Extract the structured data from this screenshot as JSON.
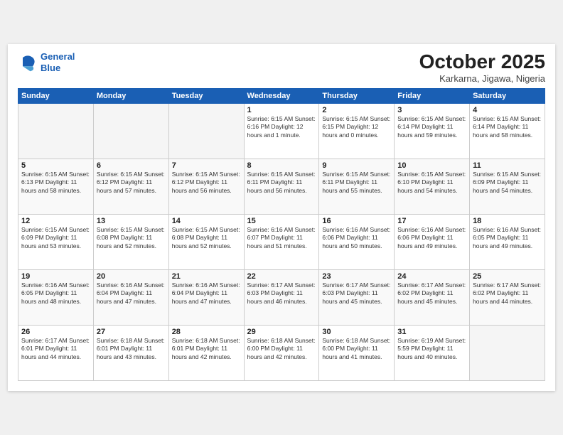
{
  "header": {
    "logo_line1": "General",
    "logo_line2": "Blue",
    "month_title": "October 2025",
    "location": "Karkarna, Jigawa, Nigeria"
  },
  "weekdays": [
    "Sunday",
    "Monday",
    "Tuesday",
    "Wednesday",
    "Thursday",
    "Friday",
    "Saturday"
  ],
  "weeks": [
    [
      {
        "num": "",
        "info": ""
      },
      {
        "num": "",
        "info": ""
      },
      {
        "num": "",
        "info": ""
      },
      {
        "num": "1",
        "info": "Sunrise: 6:15 AM\nSunset: 6:16 PM\nDaylight: 12 hours\nand 1 minute."
      },
      {
        "num": "2",
        "info": "Sunrise: 6:15 AM\nSunset: 6:15 PM\nDaylight: 12 hours\nand 0 minutes."
      },
      {
        "num": "3",
        "info": "Sunrise: 6:15 AM\nSunset: 6:14 PM\nDaylight: 11 hours\nand 59 minutes."
      },
      {
        "num": "4",
        "info": "Sunrise: 6:15 AM\nSunset: 6:14 PM\nDaylight: 11 hours\nand 58 minutes."
      }
    ],
    [
      {
        "num": "5",
        "info": "Sunrise: 6:15 AM\nSunset: 6:13 PM\nDaylight: 11 hours\nand 58 minutes."
      },
      {
        "num": "6",
        "info": "Sunrise: 6:15 AM\nSunset: 6:12 PM\nDaylight: 11 hours\nand 57 minutes."
      },
      {
        "num": "7",
        "info": "Sunrise: 6:15 AM\nSunset: 6:12 PM\nDaylight: 11 hours\nand 56 minutes."
      },
      {
        "num": "8",
        "info": "Sunrise: 6:15 AM\nSunset: 6:11 PM\nDaylight: 11 hours\nand 56 minutes."
      },
      {
        "num": "9",
        "info": "Sunrise: 6:15 AM\nSunset: 6:11 PM\nDaylight: 11 hours\nand 55 minutes."
      },
      {
        "num": "10",
        "info": "Sunrise: 6:15 AM\nSunset: 6:10 PM\nDaylight: 11 hours\nand 54 minutes."
      },
      {
        "num": "11",
        "info": "Sunrise: 6:15 AM\nSunset: 6:09 PM\nDaylight: 11 hours\nand 54 minutes."
      }
    ],
    [
      {
        "num": "12",
        "info": "Sunrise: 6:15 AM\nSunset: 6:09 PM\nDaylight: 11 hours\nand 53 minutes."
      },
      {
        "num": "13",
        "info": "Sunrise: 6:15 AM\nSunset: 6:08 PM\nDaylight: 11 hours\nand 52 minutes."
      },
      {
        "num": "14",
        "info": "Sunrise: 6:15 AM\nSunset: 6:08 PM\nDaylight: 11 hours\nand 52 minutes."
      },
      {
        "num": "15",
        "info": "Sunrise: 6:16 AM\nSunset: 6:07 PM\nDaylight: 11 hours\nand 51 minutes."
      },
      {
        "num": "16",
        "info": "Sunrise: 6:16 AM\nSunset: 6:06 PM\nDaylight: 11 hours\nand 50 minutes."
      },
      {
        "num": "17",
        "info": "Sunrise: 6:16 AM\nSunset: 6:06 PM\nDaylight: 11 hours\nand 49 minutes."
      },
      {
        "num": "18",
        "info": "Sunrise: 6:16 AM\nSunset: 6:05 PM\nDaylight: 11 hours\nand 49 minutes."
      }
    ],
    [
      {
        "num": "19",
        "info": "Sunrise: 6:16 AM\nSunset: 6:05 PM\nDaylight: 11 hours\nand 48 minutes."
      },
      {
        "num": "20",
        "info": "Sunrise: 6:16 AM\nSunset: 6:04 PM\nDaylight: 11 hours\nand 47 minutes."
      },
      {
        "num": "21",
        "info": "Sunrise: 6:16 AM\nSunset: 6:04 PM\nDaylight: 11 hours\nand 47 minutes."
      },
      {
        "num": "22",
        "info": "Sunrise: 6:17 AM\nSunset: 6:03 PM\nDaylight: 11 hours\nand 46 minutes."
      },
      {
        "num": "23",
        "info": "Sunrise: 6:17 AM\nSunset: 6:03 PM\nDaylight: 11 hours\nand 45 minutes."
      },
      {
        "num": "24",
        "info": "Sunrise: 6:17 AM\nSunset: 6:02 PM\nDaylight: 11 hours\nand 45 minutes."
      },
      {
        "num": "25",
        "info": "Sunrise: 6:17 AM\nSunset: 6:02 PM\nDaylight: 11 hours\nand 44 minutes."
      }
    ],
    [
      {
        "num": "26",
        "info": "Sunrise: 6:17 AM\nSunset: 6:01 PM\nDaylight: 11 hours\nand 44 minutes."
      },
      {
        "num": "27",
        "info": "Sunrise: 6:18 AM\nSunset: 6:01 PM\nDaylight: 11 hours\nand 43 minutes."
      },
      {
        "num": "28",
        "info": "Sunrise: 6:18 AM\nSunset: 6:01 PM\nDaylight: 11 hours\nand 42 minutes."
      },
      {
        "num": "29",
        "info": "Sunrise: 6:18 AM\nSunset: 6:00 PM\nDaylight: 11 hours\nand 42 minutes."
      },
      {
        "num": "30",
        "info": "Sunrise: 6:18 AM\nSunset: 6:00 PM\nDaylight: 11 hours\nand 41 minutes."
      },
      {
        "num": "31",
        "info": "Sunrise: 6:19 AM\nSunset: 5:59 PM\nDaylight: 11 hours\nand 40 minutes."
      },
      {
        "num": "",
        "info": ""
      }
    ]
  ]
}
